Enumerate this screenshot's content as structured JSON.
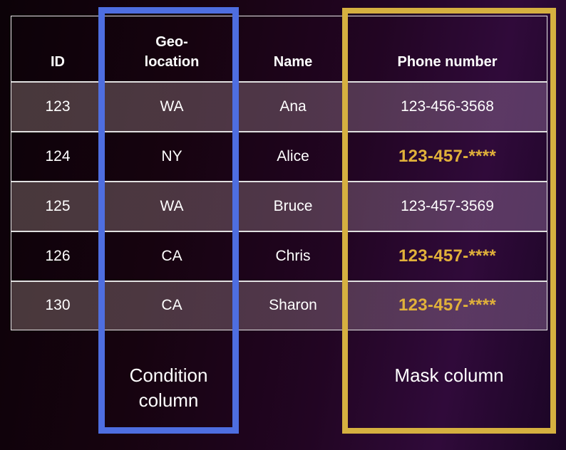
{
  "table": {
    "headers": {
      "id": "ID",
      "geo_line1": "Geo-",
      "geo_line2": "location",
      "name": "Name",
      "phone": "Phone number"
    },
    "rows": [
      {
        "id": "123",
        "geo": "WA",
        "name": "Ana",
        "phone": "123-456-3568",
        "masked": false
      },
      {
        "id": "124",
        "geo": "NY",
        "name": "Alice",
        "phone": "123-457-****",
        "masked": true
      },
      {
        "id": "125",
        "geo": "WA",
        "name": "Bruce",
        "phone": "123-457-3569",
        "masked": false
      },
      {
        "id": "126",
        "geo": "CA",
        "name": "Chris",
        "phone": "123-457-****",
        "masked": true
      },
      {
        "id": "130",
        "geo": "CA",
        "name": "Sharon",
        "phone": "123-457-****",
        "masked": true
      }
    ]
  },
  "labels": {
    "condition_line1": "Condition",
    "condition_line2": "column",
    "mask": "Mask column"
  },
  "colors": {
    "condition_box": "#4e6ee0",
    "mask_box": "#d5b040",
    "masked_text": "#e1b13a"
  }
}
